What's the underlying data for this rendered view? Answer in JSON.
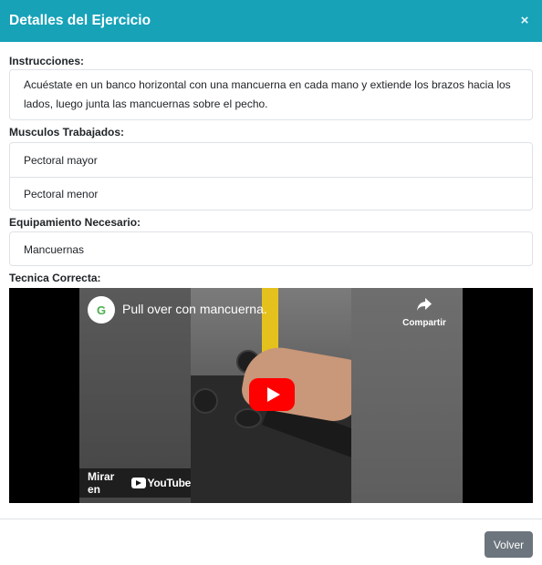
{
  "header": {
    "title": "Detalles del Ejercicio",
    "close_symbol": "×"
  },
  "instructions": {
    "label": "Instrucciones:",
    "text": "Acuéstate en un banco horizontal con una mancuerna en cada mano y extiende los brazos hacia los lados, luego junta las mancuernas sobre el pecho."
  },
  "muscles": {
    "label": "Musculos Trabajados:",
    "items": [
      "Pectoral mayor",
      "Pectoral menor"
    ]
  },
  "equipment": {
    "label": "Equipamiento Necesario:",
    "items": [
      "Mancuernas"
    ]
  },
  "technique": {
    "label": "Tecnica Correcta:",
    "video": {
      "title": "Pull over con mancuerna.",
      "share_label": "Compartir",
      "share_icon": "share-arrow-icon",
      "watch_label": "Mirar en",
      "youtube_label": "YouTube",
      "channel_logo_letter": "G",
      "play_button_color": "#ff0000"
    }
  },
  "footer": {
    "back_label": "Volver"
  },
  "colors": {
    "header_bg": "#17a2b8",
    "back_button_bg": "#6c757d"
  }
}
